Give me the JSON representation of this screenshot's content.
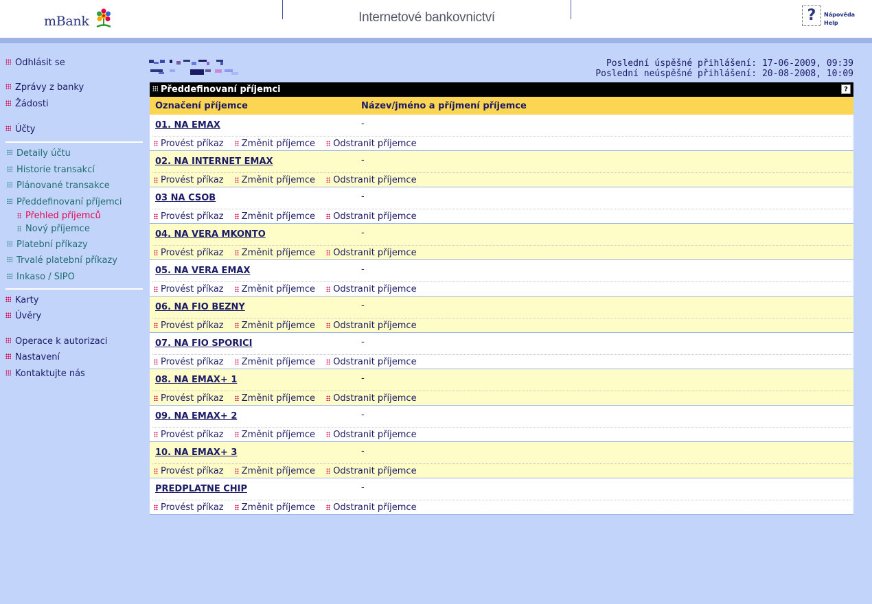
{
  "header": {
    "logo": "mBank",
    "title": "Internetové bankovnictví",
    "help_line1": "Nápověda",
    "help_line2": "Help"
  },
  "sidebar": {
    "logout": "Odhlásit se",
    "messages": "Zprávy z banky",
    "requests": "Žádosti",
    "accounts": "Účty",
    "account_details": "Detaily účtu",
    "transaction_history": "Historie transakcí",
    "planned_transactions": "Plánované transakce",
    "predefined_recipients": "Předdefinovaní příjemci",
    "recipients_overview": "Přehled příjemců",
    "new_recipient": "Nový příjemce",
    "payment_orders": "Platební příkazy",
    "standing_orders": "Trvalé platební příkazy",
    "direct_debit": "Inkaso / SIPO",
    "cards": "Karty",
    "loans": "Úvěry",
    "authorization": "Operace k autorizaci",
    "settings": "Nastavení",
    "contact": "Kontaktujte nás"
  },
  "login_info": {
    "last_success": "Poslední úspěšné přihlášení: 17-06-2009, 09:39",
    "last_fail": "Poslední neúspěšné přihlášení: 20-08-2008, 10:09"
  },
  "panel": {
    "title": "Předdefinovaní příjemci",
    "help": "?",
    "col_label": "Označení příjemce",
    "col_name": "Název/jméno a příjmení příjemce",
    "actions": {
      "execute": "Provést příkaz",
      "change": "Změnit příjemce",
      "remove": "Odstranit příjemce"
    },
    "rows": [
      {
        "label": "01. NA EMAX",
        "name": "-"
      },
      {
        "label": "02. NA INTERNET EMAX",
        "name": "-"
      },
      {
        "label": "03 NA CSOB",
        "name": "-"
      },
      {
        "label": "04. NA VERA MKONTO",
        "name": "-"
      },
      {
        "label": "05. NA VERA EMAX",
        "name": "-"
      },
      {
        "label": "06. NA FIO BEZNY",
        "name": "-"
      },
      {
        "label": "07. NA FIO SPORICI",
        "name": "-"
      },
      {
        "label": "08. NA EMAX+ 1",
        "name": "-"
      },
      {
        "label": "09. NA EMAX+ 2",
        "name": "-"
      },
      {
        "label": "10. NA EMAX+ 3",
        "name": "-"
      },
      {
        "label": "PREDPLATNE CHIP",
        "name": "-"
      }
    ]
  },
  "colors": {
    "background": "#c3d4fb",
    "header_bar": "#fcd552",
    "row_alt": "#fefdc7",
    "accent": "#d4004c"
  }
}
